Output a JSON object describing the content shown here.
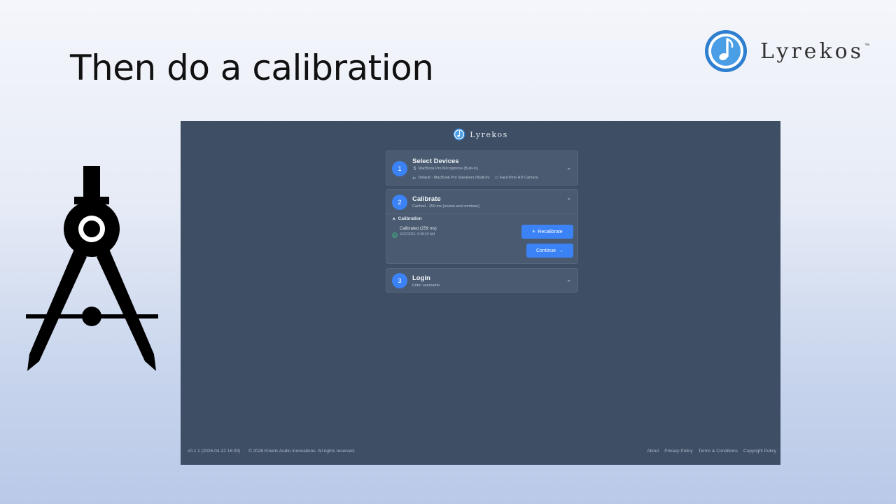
{
  "slide": {
    "title": "Then do a calibration",
    "brand_name": "Lyrekos",
    "brand_tm": "™"
  },
  "app": {
    "brand": "Lyrekos",
    "steps": [
      {
        "number": "1",
        "title": "Select Devices",
        "microphone": "MacBook Pro Microphone (Built-in)",
        "speakers": "Default - MacBook Pro Speakers (Built-in)",
        "camera": "FaceTime HD Camera",
        "state": "collapsed"
      },
      {
        "number": "2",
        "title": "Calibrate",
        "subtitle": "Cached · 259 ms (review and continue)",
        "state": "expanded",
        "section_label": "Calibration",
        "status": "Calibrated (259 ms)",
        "timestamp": "4/22/2026, 9:38:20 AM",
        "recalibrate_label": "Recalibrate",
        "continue_label": "Continue"
      },
      {
        "number": "3",
        "title": "Login",
        "subtitle": "Enter username",
        "state": "collapsed"
      }
    ],
    "footer": {
      "version": "v0.1.1 (2026-04-22 16:09)",
      "separator": "·",
      "copyright": "© 2026 Kinetic Audio Innovations. All rights reserved.",
      "links": [
        "About",
        "Privacy Policy",
        "Terms & Conditions",
        "Copyright Policy"
      ]
    }
  },
  "colors": {
    "app_bg": "#3e4e64",
    "card_bg": "#4a5b71",
    "accent": "#3b82f6",
    "success": "#3fbf7f",
    "arrow": "#ffff00"
  }
}
